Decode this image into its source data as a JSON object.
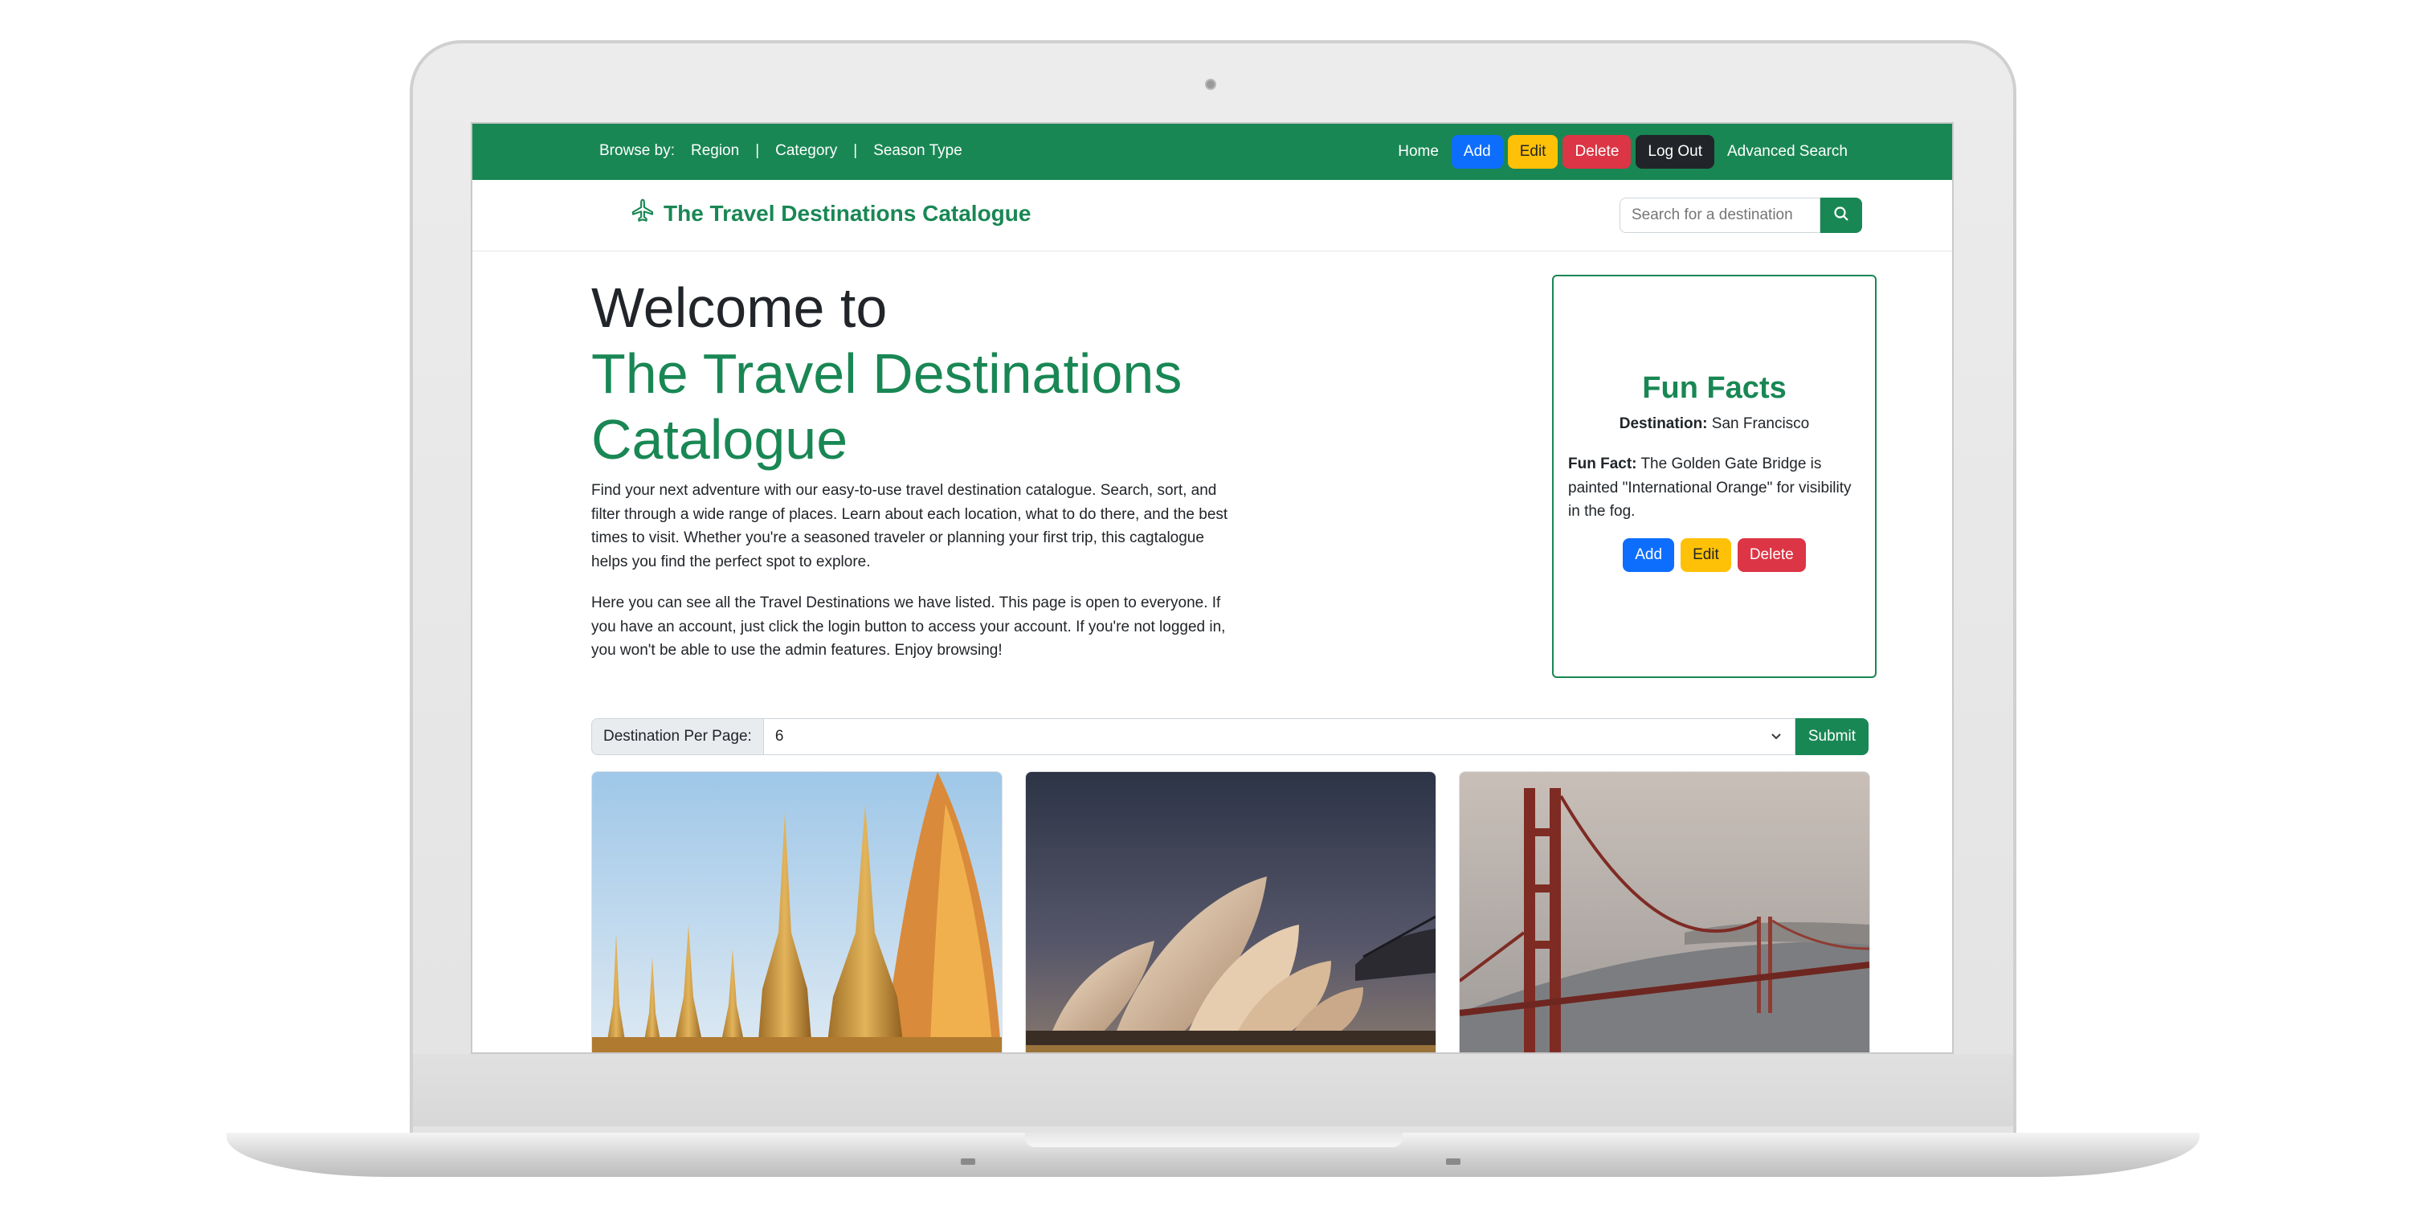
{
  "topbar": {
    "browse_label": "Browse by:",
    "browse_links": [
      "Region",
      "Category",
      "Season Type"
    ],
    "separator": "|",
    "home": "Home",
    "add": "Add",
    "edit": "Edit",
    "delete": "Delete",
    "logout": "Log Out",
    "advanced_search": "Advanced Search"
  },
  "header": {
    "brand": "The Travel Destinations Catalogue",
    "brand_icon": "airplane-icon",
    "search_placeholder": "Search for a destination",
    "search_icon": "search-icon"
  },
  "hero": {
    "line1": "Welcome to",
    "line2": "The Travel Destinations",
    "line3": "Catalogue",
    "p1": "Find your next adventure with our easy-to-use travel destination catalogue. Search, sort, and filter through a wide range of places. Learn about each location, what to do there, and the best times to visit. Whether you're a seasoned traveler or planning your first trip, this cagtalogue helps you find the perfect spot to explore.",
    "p2": "Here you can see all the Travel Destinations we have listed. This page is open to everyone. If you have an account, just click the login button to access your account. If you're not logged in, you won't be able to use the admin features. Enjoy browsing!"
  },
  "fun_facts": {
    "title": "Fun Facts",
    "destination_label": "Destination:",
    "destination": "San Francisco",
    "fact_label": "Fun Fact:",
    "fact": "The Golden Gate Bridge is painted \"International Orange\" for visibility in the fog.",
    "add": "Add",
    "edit": "Edit",
    "delete": "Delete"
  },
  "per_page": {
    "label": "Destination Per Page:",
    "value": "6",
    "submit": "Submit"
  },
  "cards": [
    {
      "image": "golden-pagoda-image"
    },
    {
      "image": "opera-house-image"
    },
    {
      "image": "golden-gate-bridge-image"
    }
  ],
  "colors": {
    "brand_green": "#198754",
    "blue": "#0d6efd",
    "yellow": "#ffc107",
    "red": "#dc3545",
    "dark": "#212529"
  }
}
